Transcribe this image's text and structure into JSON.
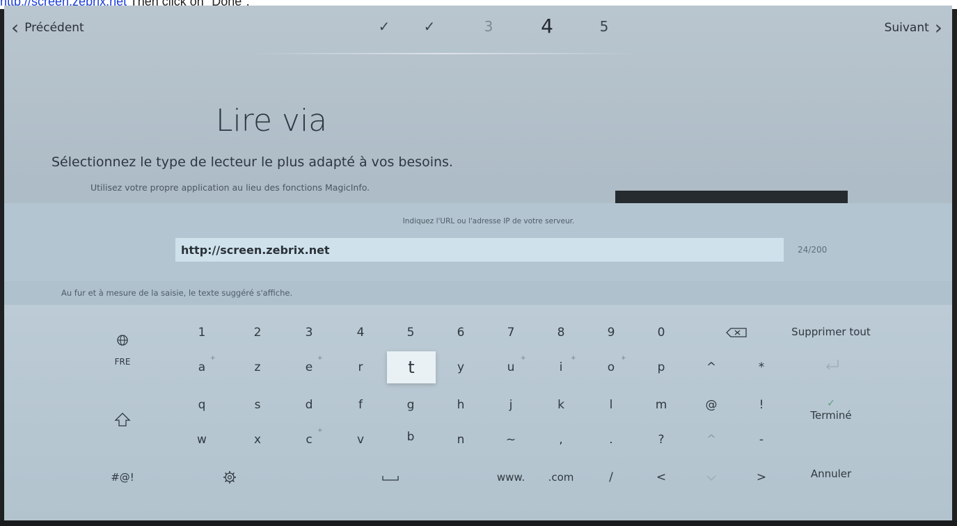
{
  "caption": {
    "link": "http://screen.zebrix.net",
    "rest": " Then click on \"Done\"."
  },
  "nav": {
    "prev": "Précédent",
    "next": "Suivant"
  },
  "steps": [
    "✓",
    "✓",
    "3",
    "4",
    "5"
  ],
  "main": {
    "title": "Lire via",
    "subtitle": "Sélectionnez le type de lecteur le plus adapté à vos besoins.",
    "hint": "Utilisez votre propre application au lieu des fonctions MagicInfo."
  },
  "input": {
    "label": "Indiquez l'URL ou l'adresse IP de votre serveur.",
    "value": "http://screen.zebrix.net",
    "counter": "24/200"
  },
  "suggest": "Au fur et à mesure de la saisie, le texte suggéré s'affiche.",
  "keyboard": {
    "lang": "FRE",
    "numbers": [
      "1",
      "2",
      "3",
      "4",
      "5",
      "6",
      "7",
      "8",
      "9",
      "0"
    ],
    "row1": [
      "a",
      "z",
      "e",
      "r",
      "t",
      "y",
      "u",
      "i",
      "o",
      "p",
      "^",
      "*"
    ],
    "row2": [
      "q",
      "s",
      "d",
      "f",
      "g",
      "h",
      "j",
      "k",
      "l",
      "m",
      "@",
      "!"
    ],
    "row3": [
      "w",
      "x",
      "c",
      "v",
      "b",
      "n",
      "~",
      ",",
      ".",
      "?",
      "^",
      "-"
    ],
    "row4": {
      "symbols": "#@!",
      "www": "www.",
      "com": ".com",
      "slash": "/",
      "lt": "<",
      "gt": ">"
    },
    "delete_all": "Supprimer tout",
    "done": "Terminé",
    "cancel": "Annuler"
  },
  "colors": {
    "accent": "#5a9e7a",
    "link": "#1a3ddb"
  }
}
